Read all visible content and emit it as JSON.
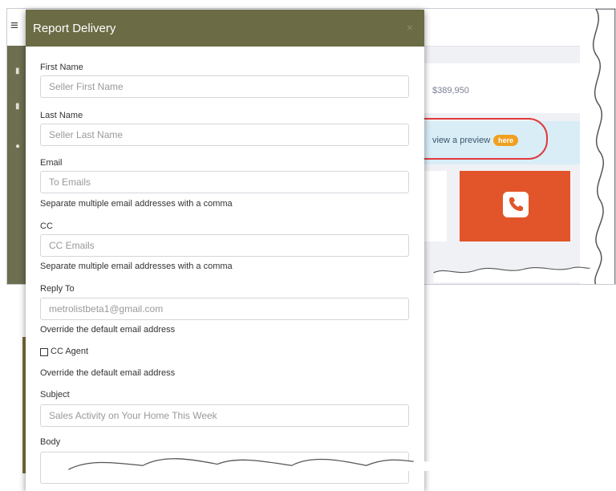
{
  "background": {
    "price": "$389,950",
    "preview_text": "view a preview",
    "preview_badge": "here"
  },
  "modal": {
    "title": "Report Delivery",
    "close": "×",
    "first_name": {
      "label": "First Name",
      "placeholder": "Seller First Name"
    },
    "last_name": {
      "label": "Last Name",
      "placeholder": "Seller Last Name"
    },
    "email": {
      "label": "Email",
      "placeholder": "To Emails",
      "help": "Separate multiple email addresses with a comma"
    },
    "cc": {
      "label": "CC",
      "placeholder": "CC Emails",
      "help": "Separate multiple email addresses with a comma"
    },
    "reply_to": {
      "label": "Reply To",
      "placeholder": "metrolistbeta1@gmail.com",
      "help": "Override the default email address"
    },
    "cc_agent": {
      "label": "CC Agent",
      "help": "Override the default email address"
    },
    "subject": {
      "label": "Subject",
      "placeholder": "Sales Activity on Your Home This Week"
    },
    "body": {
      "label": "Body"
    }
  },
  "colors": {
    "modal_header": "#6b6b45",
    "call_tile": "#e2552a",
    "highlight": "#e03a3a",
    "badge": "#f0a020"
  }
}
